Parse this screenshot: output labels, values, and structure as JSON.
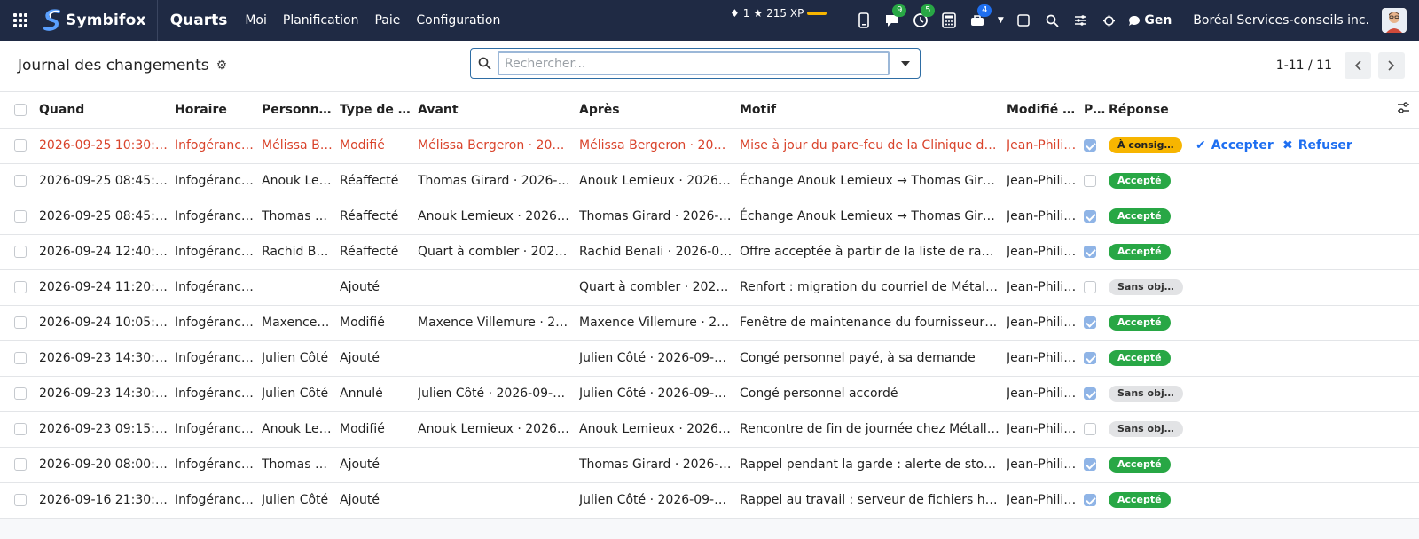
{
  "navbar": {
    "brand": "Symbifox",
    "app_title": "Quarts",
    "menu": [
      "Moi",
      "Planification",
      "Paie",
      "Configuration"
    ],
    "streak": "1",
    "xp": "215 XP",
    "chat_badge": "9",
    "activity_badge": "5",
    "lunch_badge": "4",
    "gen_label": "Gen",
    "company": "Boréal Services-conseils inc.",
    "colors": {
      "bg": "#1f2a44",
      "accent": "#f7b500"
    }
  },
  "control": {
    "title": "Journal des changements",
    "search_placeholder": "Rechercher...",
    "pager": "1-11 / 11"
  },
  "table": {
    "columns": [
      "Quand",
      "Horaire",
      "Personne…",
      "Type de c…",
      "Avant",
      "Après",
      "Motif",
      "Modifié p…",
      "P…",
      "Réponse"
    ],
    "accept_label": "Accepter",
    "refuse_label": "Refuser",
    "rows": [
      {
        "quand": "2026-09-25 10:30:00",
        "horaire": "Infogérance…",
        "personne": "Mélissa B…",
        "type": "Modifié",
        "avant": "Mélissa Bergeron · 2026-…",
        "apres": "Mélissa Bergeron · 2026-…",
        "motif": "Mise à jour du pare-feu de la Clinique den…",
        "modifie": "Jean-Phili…",
        "checked": true,
        "reponse": "À consig…",
        "status": "amber",
        "highlight": true
      },
      {
        "quand": "2026-09-25 08:45:00",
        "horaire": "Infogérance…",
        "personne": "Anouk Le…",
        "type": "Réaffecté",
        "avant": "Thomas Girard · 2026-1…",
        "apres": "Anouk Lemieux · 2026-1…",
        "motif": "Échange Anouk Lemieux → Thomas Girard",
        "modifie": "Jean-Phili…",
        "checked": false,
        "reponse": "Accepté",
        "status": "green",
        "highlight": false
      },
      {
        "quand": "2026-09-25 08:45:00",
        "horaire": "Infogérance…",
        "personne": "Thomas G…",
        "type": "Réaffecté",
        "avant": "Anouk Lemieux · 2026-0…",
        "apres": "Thomas Girard · 2026-0…",
        "motif": "Échange Anouk Lemieux → Thomas Girard",
        "modifie": "Jean-Phili…",
        "checked": true,
        "reponse": "Accepté",
        "status": "green",
        "highlight": false
      },
      {
        "quand": "2026-09-24 12:40:00",
        "horaire": "Infogérance…",
        "personne": "Rachid Be…",
        "type": "Réaffecté",
        "avant": "Quart à combler · 2026-…",
        "apres": "Rachid Benali · 2026-09…",
        "motif": "Offre acceptée à partir de la liste de rappel",
        "modifie": "Jean-Phili…",
        "checked": true,
        "reponse": "Accepté",
        "status": "green",
        "highlight": false
      },
      {
        "quand": "2026-09-24 11:20:00",
        "horaire": "Infogérance…",
        "personne": "",
        "type": "Ajouté",
        "avant": "",
        "apres": "Quart à combler · 2026-…",
        "motif": "Renfort : migration du courriel de Métallur…",
        "modifie": "Jean-Phili…",
        "checked": false,
        "reponse": "Sans obj…",
        "status": "grey",
        "highlight": false
      },
      {
        "quand": "2026-09-24 10:05:00",
        "horaire": "Infogérance…",
        "personne": "Maxence …",
        "type": "Modifié",
        "avant": "Maxence Villemure · 202…",
        "apres": "Maxence Villemure · 202…",
        "motif": "Fenêtre de maintenance du fournisseur av…",
        "modifie": "Jean-Phili…",
        "checked": true,
        "reponse": "Accepté",
        "status": "green",
        "highlight": false
      },
      {
        "quand": "2026-09-23 14:30:00",
        "horaire": "Infogérance…",
        "personne": "Julien Côté",
        "type": "Ajouté",
        "avant": "",
        "apres": "Julien Côté · 2026-09-30…",
        "motif": "Congé personnel payé, à sa demande",
        "modifie": "Jean-Phili…",
        "checked": true,
        "reponse": "Accepté",
        "status": "green",
        "highlight": false
      },
      {
        "quand": "2026-09-23 14:30:00",
        "horaire": "Infogérance…",
        "personne": "Julien Côté",
        "type": "Annulé",
        "avant": "Julien Côté · 2026-09-30…",
        "apres": "Julien Côté · 2026-09-30…",
        "motif": "Congé personnel accordé",
        "modifie": "Jean-Phili…",
        "checked": true,
        "reponse": "Sans obj…",
        "status": "grey",
        "highlight": false
      },
      {
        "quand": "2026-09-23 09:15:00",
        "horaire": "Infogérance…",
        "personne": "Anouk Le…",
        "type": "Modifié",
        "avant": "Anouk Lemieux · 2026-1…",
        "apres": "Anouk Lemieux · 2026-1…",
        "motif": "Rencontre de fin de journée chez Métallur…",
        "modifie": "Jean-Phili…",
        "checked": false,
        "reponse": "Sans obj…",
        "status": "grey",
        "highlight": false
      },
      {
        "quand": "2026-09-20 08:00:00",
        "horaire": "Infogérance…",
        "personne": "Thomas G…",
        "type": "Ajouté",
        "avant": "",
        "apres": "Thomas Girard · 2026-0…",
        "motif": "Rappel pendant la garde : alerte de stock…",
        "modifie": "Jean-Phili…",
        "checked": true,
        "reponse": "Accepté",
        "status": "green",
        "highlight": false
      },
      {
        "quand": "2026-09-16 21:30:00",
        "horaire": "Infogérance…",
        "personne": "Julien Côté",
        "type": "Ajouté",
        "avant": "",
        "apres": "Julien Côté · 2026-09-16…",
        "motif": "Rappel au travail : serveur de fichiers hor…",
        "modifie": "Jean-Phili…",
        "checked": true,
        "reponse": "Accepté",
        "status": "green",
        "highlight": false
      }
    ]
  }
}
